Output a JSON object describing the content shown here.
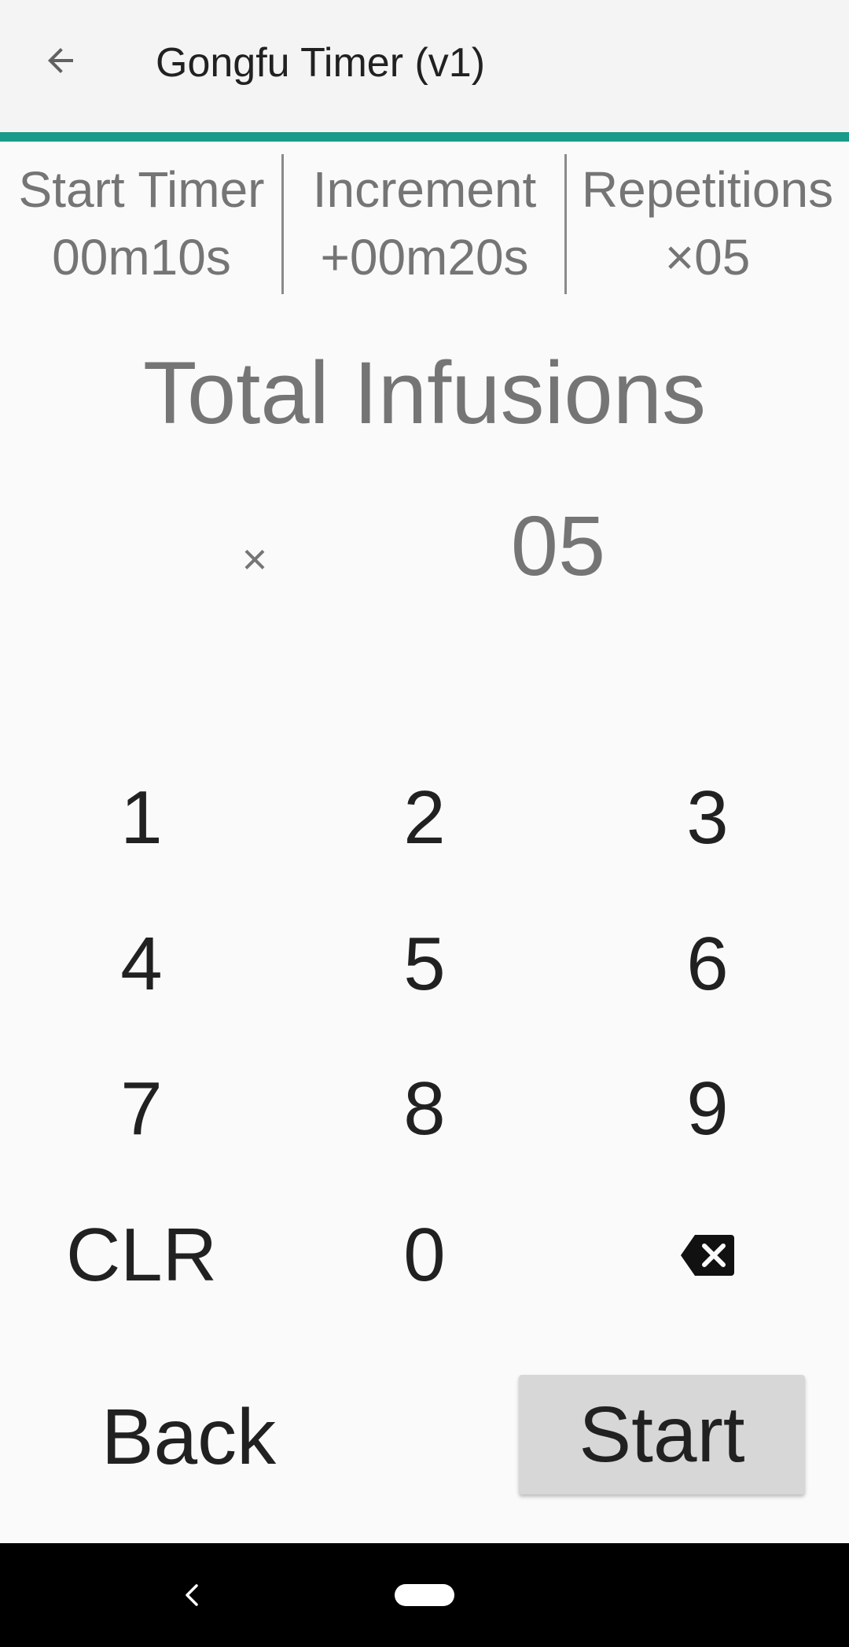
{
  "app_bar": {
    "title": "Gongfu Timer (v1)",
    "back_icon": "arrow-left-icon",
    "accent_color": "#1a9a88"
  },
  "summary": {
    "start_timer": {
      "label": "Start Timer",
      "value": "00m10s"
    },
    "increment": {
      "label": "Increment",
      "value": "+00m20s"
    },
    "repetitions": {
      "label": "Repetitions",
      "value": "×05"
    }
  },
  "entry": {
    "heading": "Total Infusions",
    "multiplier": "×",
    "value": "05"
  },
  "keypad": {
    "keys": [
      "1",
      "2",
      "3",
      "4",
      "5",
      "6",
      "7",
      "8",
      "9",
      "CLR",
      "0"
    ],
    "backspace_icon": "backspace-icon"
  },
  "actions": {
    "back_label": "Back",
    "start_label": "Start"
  },
  "nav_bar": {
    "back_icon": "nav-back-icon",
    "home_icon": "nav-home-pill-icon"
  }
}
